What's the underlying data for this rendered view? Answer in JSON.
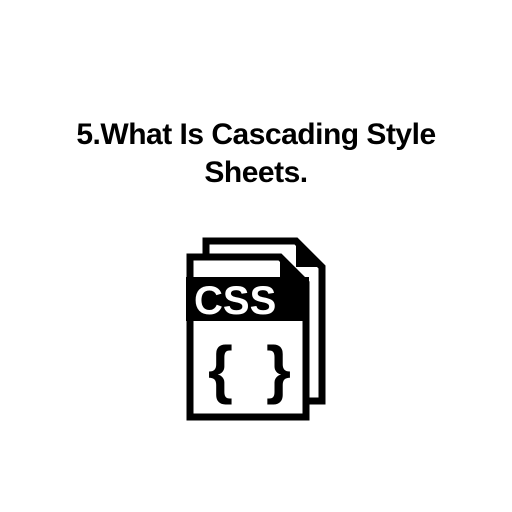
{
  "heading": "5.What Is Cascading Style Sheets.",
  "icon_label": "CSS"
}
